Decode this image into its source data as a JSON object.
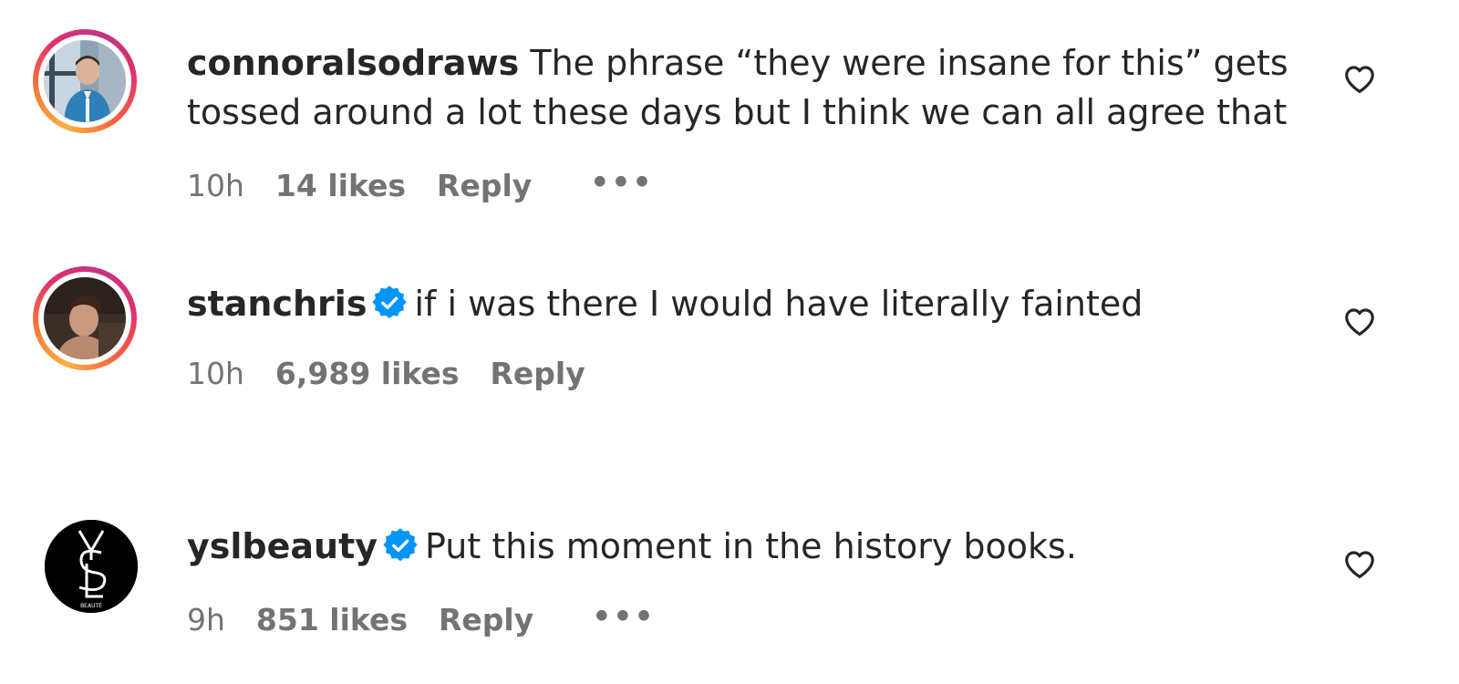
{
  "comments": [
    {
      "username": "connoralsodraws",
      "verified": false,
      "text_line1": "The phrase “they were insane for this” gets",
      "text_line2": "tossed around a lot these days but I think we can all agree that",
      "time": "10h",
      "likes": "14 likes",
      "reply": "Reply",
      "more": "•••"
    },
    {
      "username": "stanchris",
      "verified": true,
      "text_line1": "if i was there I would have literally fainted",
      "time": "10h",
      "likes": "6,989 likes",
      "reply": "Reply"
    },
    {
      "username": "yslbeauty",
      "verified": true,
      "text_line1": "Put this moment in the history books.",
      "time": "9h",
      "likes": "851 likes",
      "reply": "Reply",
      "more": "•••",
      "avatar_logo_text": "BEAUTÉ"
    }
  ],
  "colors": {
    "text": "#262626",
    "meta": "#737373",
    "verified": "#0095f6"
  },
  "icons": {
    "like": "heart-icon",
    "verified": "verified-badge-icon"
  }
}
